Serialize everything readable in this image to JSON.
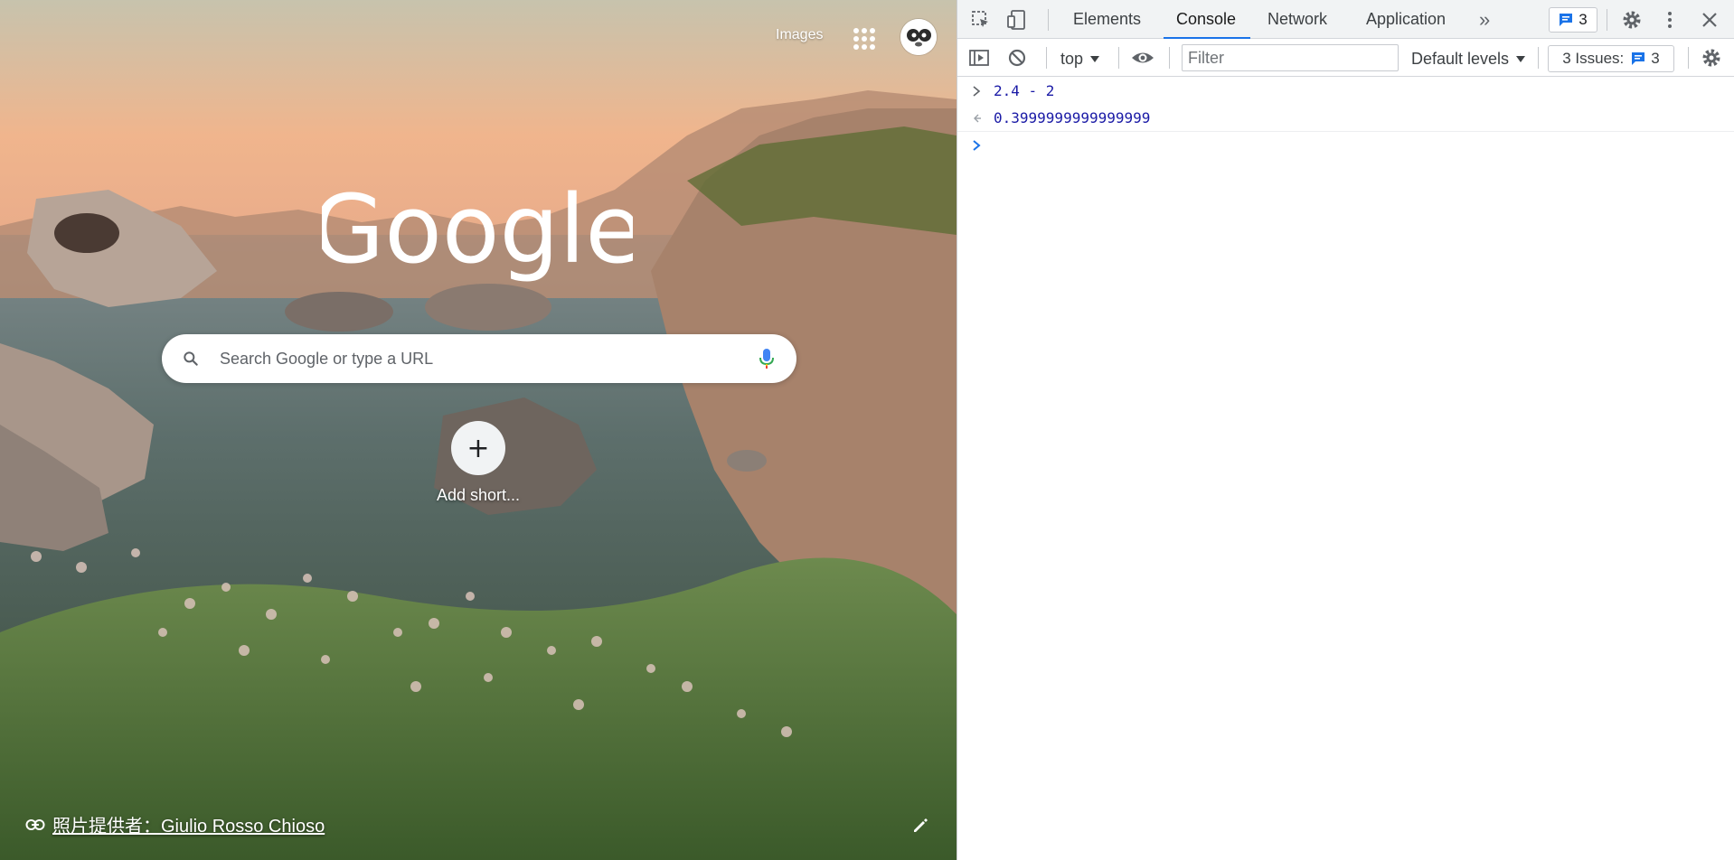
{
  "ntp": {
    "images_link": "Images",
    "logo_text": "Google",
    "search": {
      "placeholder": "Search Google or type a URL"
    },
    "shortcut": {
      "symbol": "+",
      "label": "Add short..."
    },
    "attribution": "照片提供者：Giulio Rosso Chioso"
  },
  "devtools": {
    "tabs": [
      {
        "label": "Elements",
        "active": false
      },
      {
        "label": "Console",
        "active": true
      },
      {
        "label": "Network",
        "active": false
      },
      {
        "label": "Application",
        "active": false
      }
    ],
    "more_tabs_symbol": "»",
    "issues_badge_count": "3",
    "toolbar": {
      "context": "top",
      "filter_placeholder": "Filter",
      "levels": "Default levels",
      "issues_label": "3 Issues:",
      "issues_count": "3"
    },
    "console": [
      {
        "type": "input",
        "text": "2.4 - 2"
      },
      {
        "type": "result",
        "text": "0.3999999999999999"
      }
    ]
  },
  "colors": {
    "accent": "#1a73e8",
    "console_value": "#1a1aa6",
    "toolbar_bg": "#f1f3f4"
  }
}
